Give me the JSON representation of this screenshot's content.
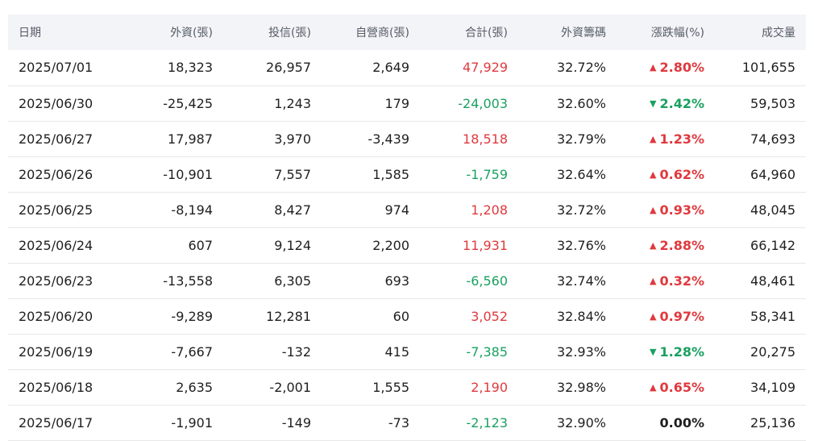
{
  "table": {
    "headers": [
      "日期",
      "外資(張)",
      "投信(張)",
      "自營商(張)",
      "合計(張)",
      "外資籌碼",
      "漲跌幅(%)",
      "成交量"
    ],
    "rows": [
      {
        "date": "2025/07/01",
        "foreign": "18,323",
        "trust": "26,957",
        "dealer": "2,649",
        "total": "47,929",
        "total_dir": "up",
        "holding": "32.72%",
        "change": "2.80%",
        "change_dir": "up",
        "volume": "101,655"
      },
      {
        "date": "2025/06/30",
        "foreign": "-25,425",
        "trust": "1,243",
        "dealer": "179",
        "total": "-24,003",
        "total_dir": "down",
        "holding": "32.60%",
        "change": "2.42%",
        "change_dir": "down",
        "volume": "59,503"
      },
      {
        "date": "2025/06/27",
        "foreign": "17,987",
        "trust": "3,970",
        "dealer": "-3,439",
        "total": "18,518",
        "total_dir": "up",
        "holding": "32.79%",
        "change": "1.23%",
        "change_dir": "up",
        "volume": "74,693"
      },
      {
        "date": "2025/06/26",
        "foreign": "-10,901",
        "trust": "7,557",
        "dealer": "1,585",
        "total": "-1,759",
        "total_dir": "down",
        "holding": "32.64%",
        "change": "0.62%",
        "change_dir": "up",
        "volume": "64,960"
      },
      {
        "date": "2025/06/25",
        "foreign": "-8,194",
        "trust": "8,427",
        "dealer": "974",
        "total": "1,208",
        "total_dir": "up",
        "holding": "32.72%",
        "change": "0.93%",
        "change_dir": "up",
        "volume": "48,045"
      },
      {
        "date": "2025/06/24",
        "foreign": "607",
        "trust": "9,124",
        "dealer": "2,200",
        "total": "11,931",
        "total_dir": "up",
        "holding": "32.76%",
        "change": "2.88%",
        "change_dir": "up",
        "volume": "66,142"
      },
      {
        "date": "2025/06/23",
        "foreign": "-13,558",
        "trust": "6,305",
        "dealer": "693",
        "total": "-6,560",
        "total_dir": "down",
        "holding": "32.74%",
        "change": "0.32%",
        "change_dir": "up",
        "volume": "48,461"
      },
      {
        "date": "2025/06/20",
        "foreign": "-9,289",
        "trust": "12,281",
        "dealer": "60",
        "total": "3,052",
        "total_dir": "up",
        "holding": "32.84%",
        "change": "0.97%",
        "change_dir": "up",
        "volume": "58,341"
      },
      {
        "date": "2025/06/19",
        "foreign": "-7,667",
        "trust": "-132",
        "dealer": "415",
        "total": "-7,385",
        "total_dir": "down",
        "holding": "32.93%",
        "change": "1.28%",
        "change_dir": "down",
        "volume": "20,275"
      },
      {
        "date": "2025/06/18",
        "foreign": "2,635",
        "trust": "-2,001",
        "dealer": "1,555",
        "total": "2,190",
        "total_dir": "up",
        "holding": "32.98%",
        "change": "0.65%",
        "change_dir": "up",
        "volume": "34,109"
      },
      {
        "date": "2025/06/17",
        "foreign": "-1,901",
        "trust": "-149",
        "dealer": "-73",
        "total": "-2,123",
        "total_dir": "down",
        "holding": "32.90%",
        "change": "0.00%",
        "change_dir": "flat",
        "volume": "25,136"
      }
    ]
  },
  "colors": {
    "up": "#e0393e",
    "down": "#1aa160",
    "header_bg": "#f2f4f7"
  },
  "icons": {
    "up": "triangle-up-icon",
    "down": "triangle-down-icon"
  }
}
